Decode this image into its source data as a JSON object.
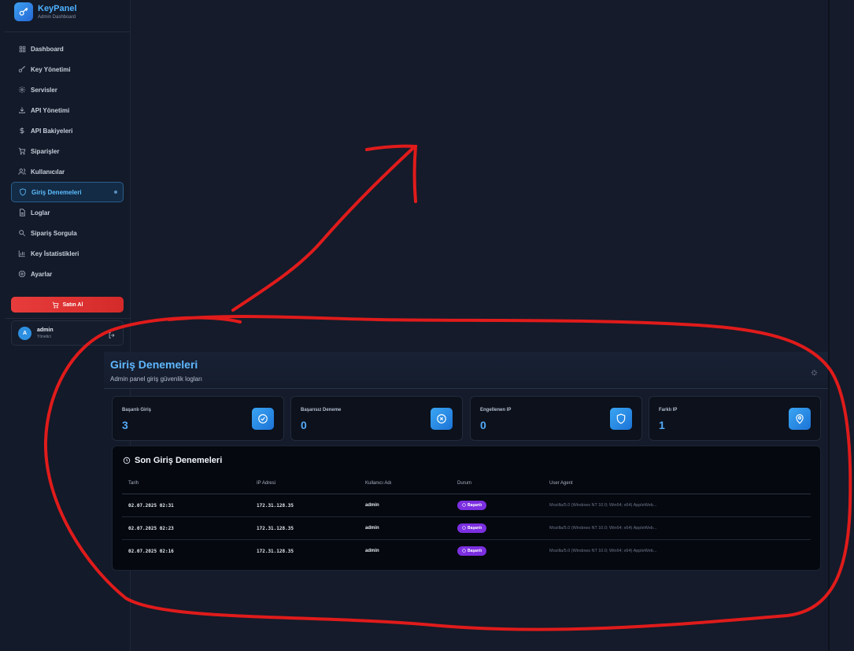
{
  "brand": {
    "name": "KeyPanel",
    "subtitle": "Admin Dashboard",
    "icon": "key-icon"
  },
  "sidebar": {
    "items": [
      {
        "label": "Dashboard",
        "icon": "grid-icon"
      },
      {
        "label": "Key Yönetimi",
        "icon": "key-icon"
      },
      {
        "label": "Servisler",
        "icon": "gear-icon"
      },
      {
        "label": "API Yönetimi",
        "icon": "download-icon"
      },
      {
        "label": "API Bakiyeleri",
        "icon": "dollar-icon"
      },
      {
        "label": "Siparişler",
        "icon": "cart-icon"
      },
      {
        "label": "Kullanıcılar",
        "icon": "users-icon"
      },
      {
        "label": "Giriş Denemeleri",
        "icon": "shield-icon",
        "active": true
      },
      {
        "label": "Loglar",
        "icon": "file-icon"
      },
      {
        "label": "Sipariş Sorgula",
        "icon": "search-icon"
      },
      {
        "label": "Key İstatistikleri",
        "icon": "bar-chart-icon"
      },
      {
        "label": "Ayarlar",
        "icon": "settings-icon"
      }
    ],
    "buy_label": "Satın Al"
  },
  "user": {
    "initial": "A",
    "name": "admin",
    "role": "Yönetici"
  },
  "page": {
    "title": "Giriş Denemeleri",
    "subtitle": "Admin panel giriş güvenlik logları"
  },
  "stats": [
    {
      "label": "Başarılı Giriş",
      "value": "3",
      "icon": "check-circle-icon"
    },
    {
      "label": "Başarısız Deneme",
      "value": "0",
      "icon": "x-circle-icon"
    },
    {
      "label": "Engellenen IP",
      "value": "0",
      "icon": "shield-icon"
    },
    {
      "label": "Farklı IP",
      "value": "1",
      "icon": "map-pin-icon"
    }
  ],
  "log_table": {
    "title": "Son Giriş Denemeleri",
    "columns": [
      "Tarih",
      "IP Adresi",
      "Kullanıcı Adı",
      "Durum",
      "User Agent"
    ],
    "rows": [
      {
        "date": "02.07.2025 02:31",
        "ip": "172.31.128.35",
        "user": "admin",
        "status": "Başarılı",
        "agent": "Mozilla/5.0 (Windows NT 10.0; Win64; x64) AppleWeb..."
      },
      {
        "date": "02.07.2025 02:23",
        "ip": "172.31.128.35",
        "user": "admin",
        "status": "Başarılı",
        "agent": "Mozilla/5.0 (Windows NT 10.0; Win64; x64) AppleWeb..."
      },
      {
        "date": "02.07.2025 02:16",
        "ip": "172.31.128.35",
        "user": "admin",
        "status": "Başarılı",
        "agent": "Mozilla/5.0 (Windows NT 10.0; Win64; x64) AppleWeb..."
      }
    ]
  },
  "colors": {
    "accent": "#4fb3ff",
    "danger": "#e83c3c",
    "badge": "#7b2fe0",
    "annotation": "#e01b1b"
  }
}
